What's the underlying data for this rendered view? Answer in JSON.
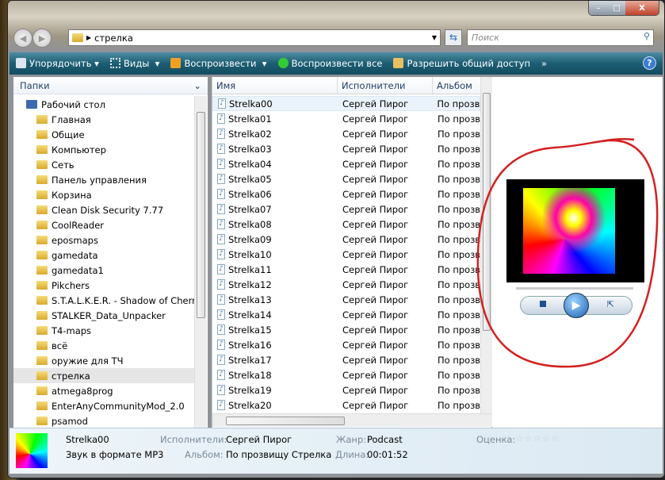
{
  "window": {
    "controls": {
      "minimize": "–",
      "maximize": "□",
      "close": "X"
    }
  },
  "address": {
    "path": "стрелка",
    "search_placeholder": "Поиск"
  },
  "toolbar": {
    "organize": "Упорядочить",
    "views": "Виды",
    "play": "Воспроизвести",
    "play_all": "Воспроизвести все",
    "share": "Разрешить общий доступ",
    "more": "»",
    "help": "?"
  },
  "folders": {
    "header": "Папки",
    "items": [
      "Рабочий стол",
      "Главная",
      "Общие",
      "Компьютер",
      "Сеть",
      "Панель управления",
      "Корзина",
      "Clean Disk Security 7.77",
      "CoolReader",
      "eposmaps",
      "gamedata",
      "gamedata1",
      "Pikchers",
      "S.T.A.L.K.E.R. - Shadow of Cherno",
      "STALKER_Data_Unpacker",
      "T4-maps",
      "всё",
      "оружие для ТЧ",
      "стрелка",
      "atmega8prog",
      "EnterAnyCommunityMod_2.0",
      "psamod"
    ],
    "selected": "стрелка"
  },
  "files": {
    "columns": [
      "Имя",
      "Исполнители",
      "Альбом"
    ],
    "rows": [
      [
        "Strelka00",
        "Сергей Пирог",
        "По прозви"
      ],
      [
        "Strelka01",
        "Сергей Пирог",
        "По прозви"
      ],
      [
        "Strelka02",
        "Сергей Пирог",
        "По прозви"
      ],
      [
        "Strelka03",
        "Сергей Пирог",
        "По прозви"
      ],
      [
        "Strelka04",
        "Сергей Пирог",
        "По прозви"
      ],
      [
        "Strelka05",
        "Сергей Пирог",
        "По прозви"
      ],
      [
        "Strelka06",
        "Сергей Пирог",
        "По прозви"
      ],
      [
        "Strelka07",
        "Сергей Пирог",
        "По прозви"
      ],
      [
        "Strelka08",
        "Сергей Пирог",
        "По прозви"
      ],
      [
        "Strelka09",
        "Сергей Пирог",
        "По прозви"
      ],
      [
        "Strelka10",
        "Сергей Пирог",
        "По прозви"
      ],
      [
        "Strelka11",
        "Сергей Пирог",
        "По прозви"
      ],
      [
        "Strelka12",
        "Сергей Пирог",
        "По прозви"
      ],
      [
        "Strelka13",
        "Сергей Пирог",
        "По прозви"
      ],
      [
        "Strelka14",
        "Сергей Пирог",
        "По прозви"
      ],
      [
        "Strelka15",
        "Сергей Пирог",
        "По прозви"
      ],
      [
        "Strelka16",
        "Сергей Пирог",
        "По прозви"
      ],
      [
        "Strelka17",
        "Сергей Пирог",
        "По прозви"
      ],
      [
        "Strelka18",
        "Сергей Пирог",
        "По прозви"
      ],
      [
        "Strelka19",
        "Сергей Пирог",
        "По прозви"
      ],
      [
        "Strelka20",
        "Сергей Пирог",
        "По прозви"
      ]
    ]
  },
  "details": {
    "name": "Strelka00",
    "type": "Звук в формате MP3",
    "artists_label": "Исполнители:",
    "artists": "Сергей Пирог",
    "album_label": "Альбом:",
    "album": "По прозвищу Стрелка",
    "genre_label": "Жанр:",
    "genre": "Podcast",
    "length_label": "Длина:",
    "length": "00:01:52",
    "rating_label": "Оценка:",
    "rating": 0
  },
  "colors": {
    "toolbar": "#1d5e74",
    "annotation": "#d42020"
  }
}
